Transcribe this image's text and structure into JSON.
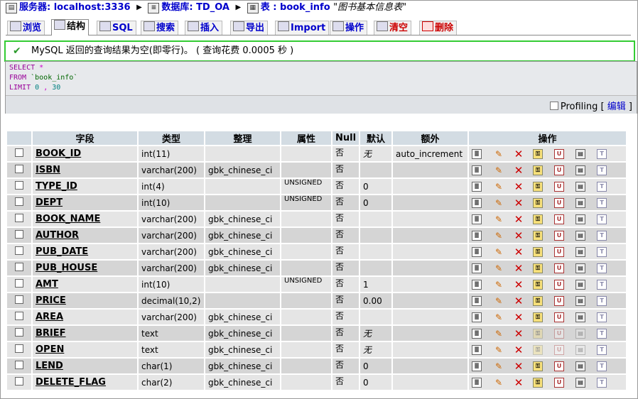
{
  "breadcrumb": {
    "server_label": "服务器: localhost:3336",
    "db_label": "数据库: TD_OA",
    "table_label": "表 : book_info",
    "table_comment": "\"图书基本信息表\""
  },
  "tabs": [
    {
      "label": "浏览",
      "icon": "browse-icon"
    },
    {
      "label": "结构",
      "icon": "structure-icon"
    },
    {
      "label": "SQL",
      "icon": "sql-icon"
    },
    {
      "label": "搜索",
      "icon": "search-icon"
    },
    {
      "label": "插入",
      "icon": "insert-icon"
    },
    {
      "label": "导出",
      "icon": "export-icon"
    },
    {
      "label": "Import",
      "icon": "import-icon"
    },
    {
      "label": "操作",
      "icon": "operations-icon"
    },
    {
      "label": "清空",
      "icon": "empty-icon"
    },
    {
      "label": "删除",
      "icon": "drop-icon"
    }
  ],
  "active_tab": "结构",
  "message": "MySQL 返回的查询结果为空(即零行)。 ( 查询花费 0.0005 秒 )",
  "sql": {
    "kw_select": "SELECT",
    "star": "*",
    "kw_from": "FROM",
    "table": "`book_info`",
    "kw_limit": "LIMIT",
    "offset": "0",
    "comma": ",",
    "count": "30"
  },
  "profiling_label": "Profiling",
  "edit_link": "编辑",
  "bracket_open": "[",
  "bracket_close": "]",
  "columns": [
    "字段",
    "类型",
    "整理",
    "属性",
    "Null",
    "默认",
    "额外",
    "操作"
  ],
  "rows": [
    {
      "field": "BOOK_ID",
      "type": "int(11)",
      "collation": "",
      "attr": "",
      "null": "否",
      "default": "无",
      "extra": "auto_increment",
      "default_italic": true
    },
    {
      "field": "ISBN",
      "type": "varchar(200)",
      "collation": "gbk_chinese_ci",
      "attr": "",
      "null": "否",
      "default": "",
      "extra": ""
    },
    {
      "field": "TYPE_ID",
      "type": "int(4)",
      "collation": "",
      "attr": "UNSIGNED",
      "null": "否",
      "default": "0",
      "extra": ""
    },
    {
      "field": "DEPT",
      "type": "int(10)",
      "collation": "",
      "attr": "UNSIGNED",
      "null": "否",
      "default": "0",
      "extra": ""
    },
    {
      "field": "BOOK_NAME",
      "type": "varchar(200)",
      "collation": "gbk_chinese_ci",
      "attr": "",
      "null": "否",
      "default": "",
      "extra": ""
    },
    {
      "field": "AUTHOR",
      "type": "varchar(200)",
      "collation": "gbk_chinese_ci",
      "attr": "",
      "null": "否",
      "default": "",
      "extra": ""
    },
    {
      "field": "PUB_DATE",
      "type": "varchar(200)",
      "collation": "gbk_chinese_ci",
      "attr": "",
      "null": "否",
      "default": "",
      "extra": ""
    },
    {
      "field": "PUB_HOUSE",
      "type": "varchar(200)",
      "collation": "gbk_chinese_ci",
      "attr": "",
      "null": "否",
      "default": "",
      "extra": ""
    },
    {
      "field": "AMT",
      "type": "int(10)",
      "collation": "",
      "attr": "UNSIGNED",
      "null": "否",
      "default": "1",
      "extra": ""
    },
    {
      "field": "PRICE",
      "type": "decimal(10,2)",
      "collation": "",
      "attr": "",
      "null": "否",
      "default": "0.00",
      "extra": ""
    },
    {
      "field": "AREA",
      "type": "varchar(200)",
      "collation": "gbk_chinese_ci",
      "attr": "",
      "null": "否",
      "default": "",
      "extra": ""
    },
    {
      "field": "BRIEF",
      "type": "text",
      "collation": "gbk_chinese_ci",
      "attr": "",
      "null": "否",
      "default": "无",
      "extra": "",
      "default_italic": true,
      "text_type": true
    },
    {
      "field": "OPEN",
      "type": "text",
      "collation": "gbk_chinese_ci",
      "attr": "",
      "null": "否",
      "default": "无",
      "extra": "",
      "default_italic": true,
      "text_type": true
    },
    {
      "field": "LEND",
      "type": "char(1)",
      "collation": "gbk_chinese_ci",
      "attr": "",
      "null": "否",
      "default": "0",
      "extra": ""
    },
    {
      "field": "DELETE_FLAG",
      "type": "char(2)",
      "collation": "gbk_chinese_ci",
      "attr": "",
      "null": "否",
      "default": "0",
      "extra": ""
    }
  ],
  "row_action_icons": [
    "browse-distinct-icon",
    "edit-icon",
    "drop-icon",
    "primary-key-icon",
    "unique-icon",
    "index-icon",
    "fulltext-icon"
  ],
  "colors": {
    "success_border": "#33cc33",
    "header_bg": "#d3dce3",
    "row_odd": "#e5e5e5",
    "row_even": "#d5d5d5",
    "link": "#0000cc"
  }
}
